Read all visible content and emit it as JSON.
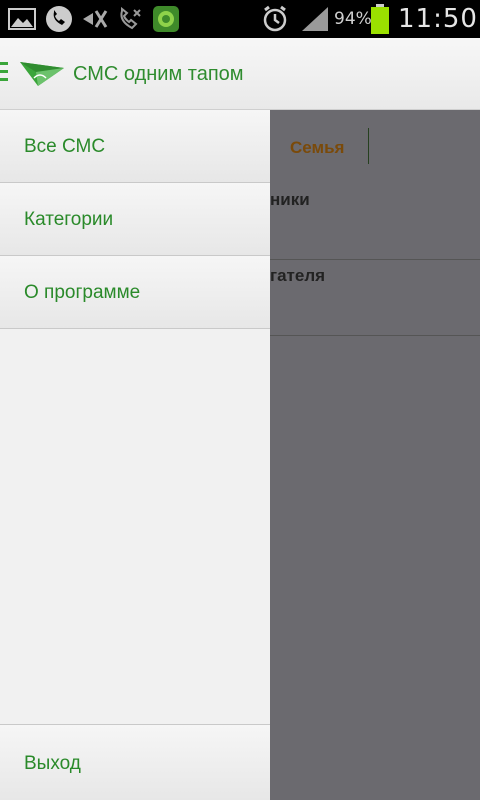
{
  "status_bar": {
    "battery_percent": "94%",
    "time": "11:50",
    "icons": [
      "gallery-icon",
      "phone-call-icon",
      "mute-icon",
      "missed-call-icon",
      "app-icon",
      "alarm-icon",
      "signal-icon",
      "battery-icon"
    ],
    "battery_color": "#9be000"
  },
  "action_bar": {
    "title": "СМС одним тапом",
    "accent_color": "#2f8c2f"
  },
  "background": {
    "tab_label": "Семья",
    "row1_text": "ники",
    "row2_text": "гателя"
  },
  "drawer": {
    "items": [
      {
        "label": "Все СМС"
      },
      {
        "label": "Категории"
      },
      {
        "label": "О программе"
      }
    ],
    "footer_label": "Выход"
  }
}
